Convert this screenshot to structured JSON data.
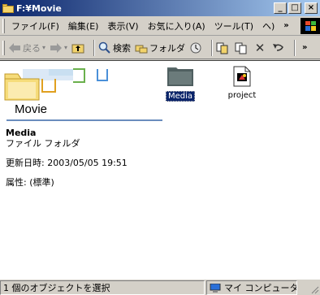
{
  "window": {
    "title": "F:¥Movie",
    "minimize_label": "_",
    "maximize_label": "□",
    "close_label": "×"
  },
  "menubar": {
    "items": [
      "ファイル(F)",
      "編集(E)",
      "表示(V)",
      "お気に入り(A)",
      "ツール(T)",
      "ヘ)"
    ],
    "overflow": "»"
  },
  "toolbar": {
    "back_label": "戻る",
    "search_label": "検索",
    "folders_label": "フォルダ",
    "overflow": "»"
  },
  "folder_view": {
    "title": "Movie",
    "selected_name": "Media",
    "selected_type": "ファイル フォルダ",
    "modified": "更新日時: 2003/05/05 19:51",
    "attributes": "属性: (標準)"
  },
  "items": [
    {
      "name": "Media",
      "selected": true
    },
    {
      "name": "project",
      "selected": false
    }
  ],
  "statusbar": {
    "selection_text": "1 個のオブジェクトを選択",
    "zone_text": "マイ コンピュータ"
  },
  "colors": {
    "titlebar_start": "#0a246a",
    "titlebar_end": "#a6caf0",
    "selection": "#0a246a",
    "chrome": "#d4d0c8"
  }
}
